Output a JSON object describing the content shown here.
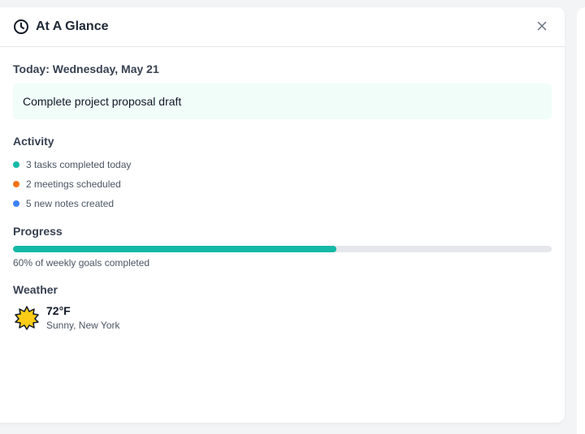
{
  "panel": {
    "title": "At A Glance",
    "icons": {
      "title": "clock-icon",
      "close": "close-icon"
    }
  },
  "today": {
    "heading": "Today: Wednesday, May 21",
    "task": "Complete project proposal draft"
  },
  "activity": {
    "heading": "Activity",
    "items": [
      {
        "text": "3 tasks completed today",
        "color": "#14b8a6"
      },
      {
        "text": "2 meetings scheduled",
        "color": "#f97316"
      },
      {
        "text": "5 new notes created",
        "color": "#3b82f6"
      }
    ]
  },
  "progress": {
    "heading": "Progress",
    "percent": 60,
    "caption": "60% of weekly goals completed",
    "color": "#14b8a6"
  },
  "weather": {
    "heading": "Weather",
    "icon": "sun-icon",
    "temperature": "72°F",
    "description": "Sunny, New York"
  }
}
